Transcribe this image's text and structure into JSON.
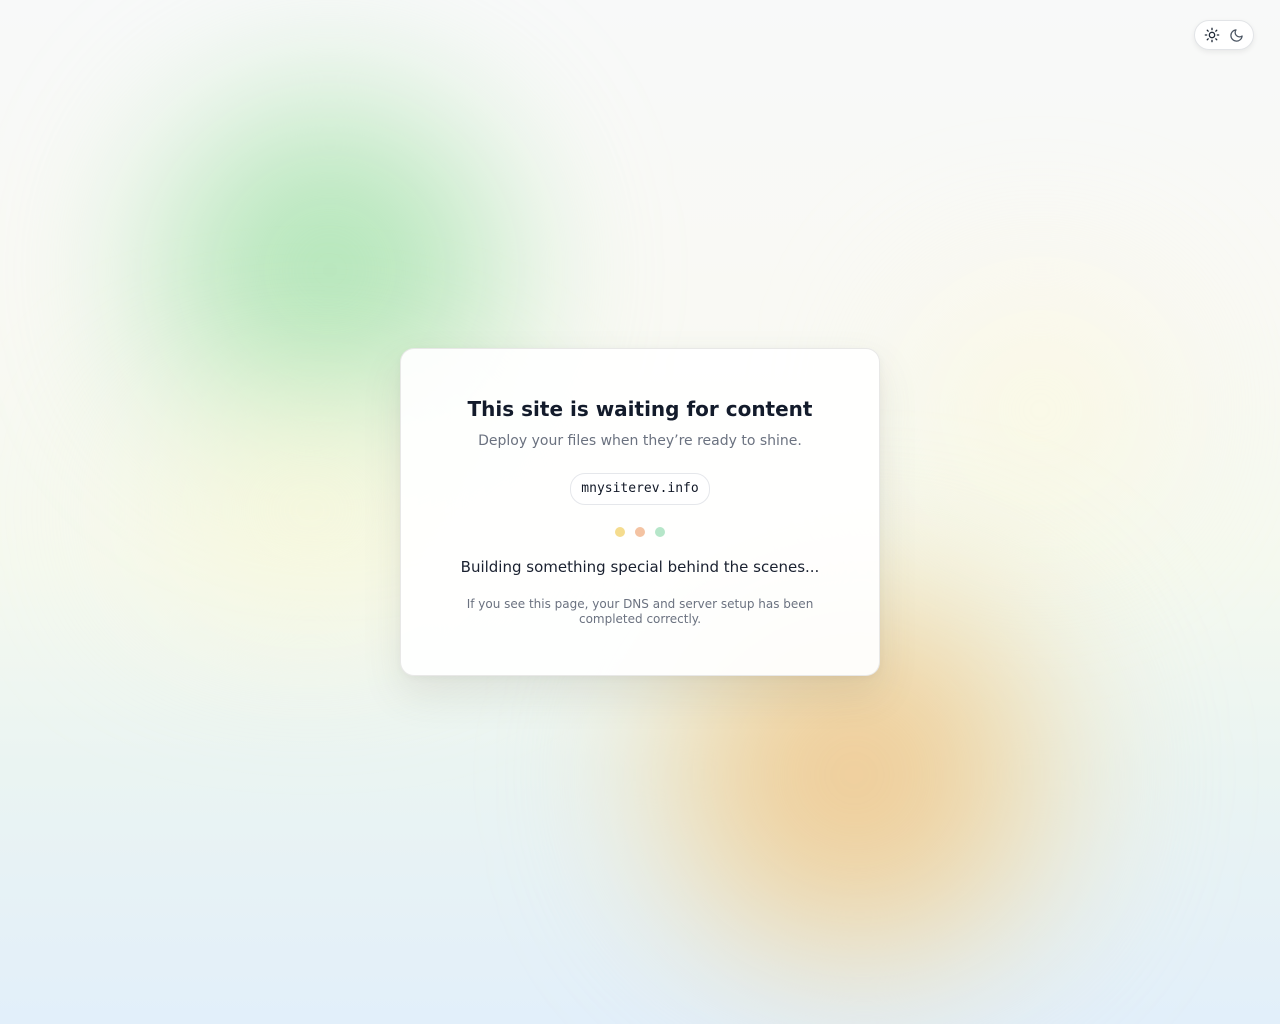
{
  "theme_toggle": {
    "light_icon": "sun-icon",
    "dark_icon": "moon-icon"
  },
  "card": {
    "title": "This site is waiting for content",
    "subtitle": "Deploy your files when they’re ready to shine.",
    "domain": "mnysiterev.info",
    "status": "Building something special behind the scenes...",
    "footnote": "If you see this page, your DNS and server setup has been completed correctly."
  },
  "colors": {
    "title": "#131b2b",
    "muted_text": "#6b7280",
    "dot_yellow": "#f5dc8e",
    "dot_orange": "#f4c3a2",
    "dot_green": "#b6e6c9",
    "blob_green": "#a0e1aa",
    "blob_orange": "#f0be82"
  }
}
